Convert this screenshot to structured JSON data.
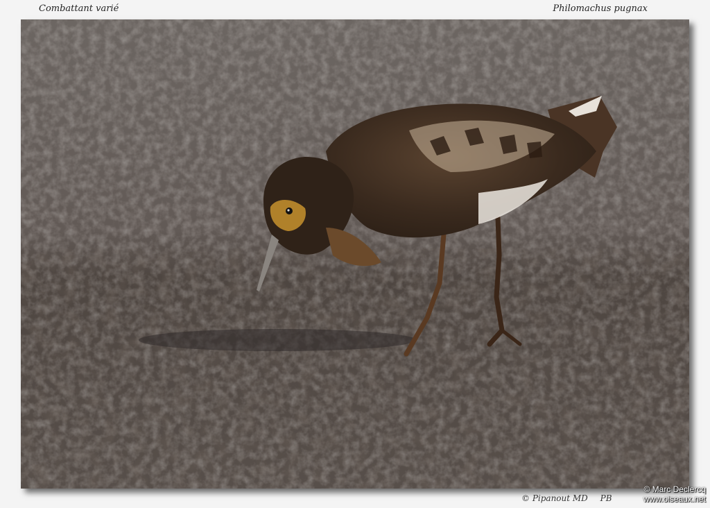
{
  "caption": {
    "common_name": "Combattant varié",
    "scientific_name": "Philomachus pugnax"
  },
  "photo": {
    "subject": "bird-foraging-in-mud"
  },
  "footer": {
    "copyright_symbol": "©",
    "author": "Pipanout MD",
    "initials": "PB"
  },
  "watermark": {
    "line1": "© Marc Declercq",
    "line2": "www.oiseaux.net"
  }
}
